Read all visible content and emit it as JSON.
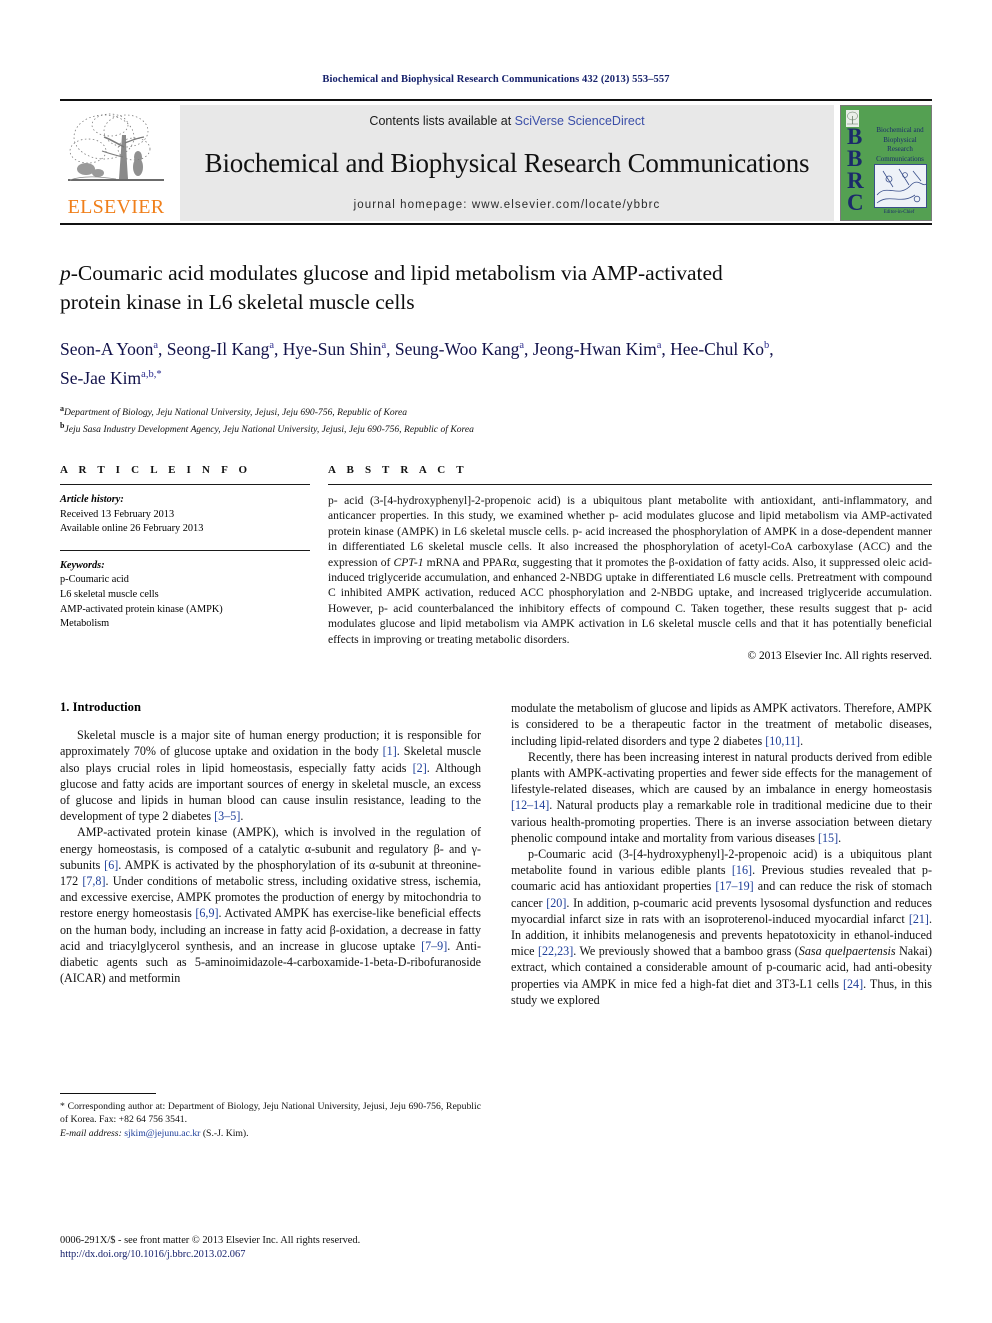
{
  "running_head": "Biochemical and Biophysical Research Communications 432 (2013) 553–557",
  "masthead": {
    "publisher_name": "ELSEVIER",
    "contents_prefix": "Contents lists available at ",
    "sciencedirect_link": "SciVerse ScienceDirect",
    "journal_title": "Biochemical and Biophysical Research Communications",
    "homepage": "journal homepage: www.elsevier.com/locate/ybbrc",
    "cover": {
      "acronym_letters": "B\nB\nR\nC",
      "title_lines": "Biochemical and\nBiophysical\nResearch\nCommunications",
      "footer_text": "Editor-in-Chief"
    },
    "colors": {
      "cover_green": "#54a052",
      "cover_blue": "#1b2a6b",
      "elsevier_orange": "#f07f1a",
      "link_blue": "#3b4fa8"
    }
  },
  "article": {
    "title_line1_italic": "p",
    "title_line1_rest": "-Coumaric acid modulates glucose and lipid metabolism via AMP-activated",
    "title_line2": "protein kinase in L6 skeletal muscle cells",
    "authors_html": "Seon-A Yoon a, Seong-Il Kang a, Hye-Sun Shin a, Seung-Woo Kang a, Jeong-Hwan Kim a, Hee-Chul Ko b, Se-Jae Kim a,b,*",
    "authors": [
      {
        "name": "Seon-A Yoon",
        "sup": "a"
      },
      {
        "name": "Seong-Il Kang",
        "sup": "a"
      },
      {
        "name": "Hye-Sun Shin",
        "sup": "a"
      },
      {
        "name": "Seung-Woo Kang",
        "sup": "a"
      },
      {
        "name": "Jeong-Hwan Kim",
        "sup": "a"
      },
      {
        "name": "Hee-Chul Ko",
        "sup": "b"
      },
      {
        "name": "Se-Jae Kim",
        "sup": "a,b,*"
      }
    ],
    "affiliations": [
      {
        "marker": "a",
        "text": "Department of Biology, Jeju National University, Jejusi, Jeju 690-756, Republic of Korea"
      },
      {
        "marker": "b",
        "text": "Jeju Sasa Industry Development Agency, Jeju National University, Jejusi, Jeju 690-756, Republic of Korea"
      }
    ]
  },
  "article_info": {
    "heading": "A R T I C L E   I N F O",
    "history_label": "Article history:",
    "history": [
      "Received 13 February 2013",
      "Available online 26 February 2013"
    ],
    "keywords_label": "Keywords:",
    "keywords": [
      "p-Coumaric acid",
      "L6 skeletal muscle cells",
      "AMP-activated protein kinase (AMPK)",
      "Metabolism"
    ]
  },
  "abstract": {
    "heading": "A B S T R A C T",
    "text": "p-Coumaric acid (3-[4-hydroxyphenyl]-2-propenoic acid) is a ubiquitous plant metabolite with antioxidant, anti-inflammatory, and anticancer properties. In this study, we examined whether p-coumaric acid modulates glucose and lipid metabolism via AMP-activated protein kinase (AMPK) in L6 skeletal muscle cells. p-Coumaric acid increased the phosphorylation of AMPK in a dose-dependent manner in differentiated L6 skeletal muscle cells. It also increased the phosphorylation of acetyl-CoA carboxylase (ACC) and the expression of CPT-1 mRNA and PPARα, suggesting that it promotes the β-oxidation of fatty acids. Also, it suppressed oleic acid-induced triglyceride accumulation, and enhanced 2-NBDG uptake in differentiated L6 muscle cells. Pretreatment with compound C inhibited AMPK activation, reduced ACC phosphorylation and 2-NBDG uptake, and increased triglyceride accumulation. However, p-coumaric acid counterbalanced the inhibitory effects of compound C. Taken together, these results suggest that p-coumaric acid modulates glucose and lipid metabolism via AMPK activation in L6 skeletal muscle cells and that it has potentially beneficial effects in improving or treating metabolic disorders.",
    "copyright": "© 2013 Elsevier Inc. All rights reserved."
  },
  "introduction": {
    "heading": "1. Introduction",
    "left_paragraphs": [
      "Skeletal muscle is a major site of human energy production; it is responsible for approximately 70% of glucose uptake and oxidation in the body [1]. Skeletal muscle also plays crucial roles in lipid homeostasis, especially fatty acids [2]. Although glucose and fatty acids are important sources of energy in skeletal muscle, an excess of glucose and lipids in human blood can cause insulin resistance, leading to the development of type 2 diabetes [3–5].",
      "AMP-activated protein kinase (AMPK), which is involved in the regulation of energy homeostasis, is composed of a catalytic α-subunit and regulatory β- and γ-subunits [6]. AMPK is activated by the phosphorylation of its α-subunit at threonine-172 [7,8]. Under conditions of metabolic stress, including oxidative stress, ischemia, and excessive exercise, AMPK promotes the production of energy by mitochondria to restore energy homeostasis [6,9]. Activated AMPK has exercise-like beneficial effects on the human body, including an increase in fatty acid β-oxidation, a decrease in fatty acid and triacylglycerol synthesis, and an increase in glucose uptake [7–9]. Anti-diabetic agents such as 5-aminoimidazole-4-carboxamide-1-beta-D-ribofuranoside (AICAR) and metformin"
    ],
    "right_paragraphs": [
      "modulate the metabolism of glucose and lipids as AMPK activators. Therefore, AMPK is considered to be a therapeutic factor in the treatment of metabolic diseases, including lipid-related disorders and type 2 diabetes [10,11].",
      "Recently, there has been increasing interest in natural products derived from edible plants with AMPK-activating properties and fewer side effects for the management of lifestyle-related diseases, which are caused by an imbalance in energy homeostasis [12–14]. Natural products play a remarkable role in traditional medicine due to their various health-promoting properties. There is an inverse association between dietary phenolic compound intake and mortality from various diseases [15].",
      "p-Coumaric acid (3-[4-hydroxyphenyl]-2-propenoic acid) is a ubiquitous plant metabolite found in various edible plants [16]. Previous studies revealed that p-coumaric acid has antioxidant properties [17–19] and can reduce the risk of stomach cancer [20]. In addition, p-coumaric acid prevents lysosomal dysfunction and reduces myocardial infarct size in rats with an isoproterenol-induced myocardial infarct [21]. In addition, it inhibits melanogenesis and prevents hepatotoxicity in ethanol-induced mice [22,23]. We previously showed that a bamboo grass (Sasa quelpaertensis Nakai) extract, which contained a considerable amount of p-coumaric acid, had anti-obesity properties via AMPK in mice fed a high-fat diet and 3T3-L1 cells [24]. Thus, in this study we explored"
    ]
  },
  "footnote": {
    "marker": "*",
    "text": "Corresponding author at: Department of Biology, Jeju National University, Jejusi, Jeju 690-756, Republic of Korea. Fax: +82 64 756 3541.",
    "email_label": "E-mail address:",
    "email": "sjkim@jejunu.ac.kr",
    "email_owner": "(S.-J. Kim)."
  },
  "page_footer": {
    "issn_line": "0006-291X/$ - see front matter © 2013 Elsevier Inc. All rights reserved.",
    "doi": "http://dx.doi.org/10.1016/j.bbrc.2013.02.067"
  }
}
